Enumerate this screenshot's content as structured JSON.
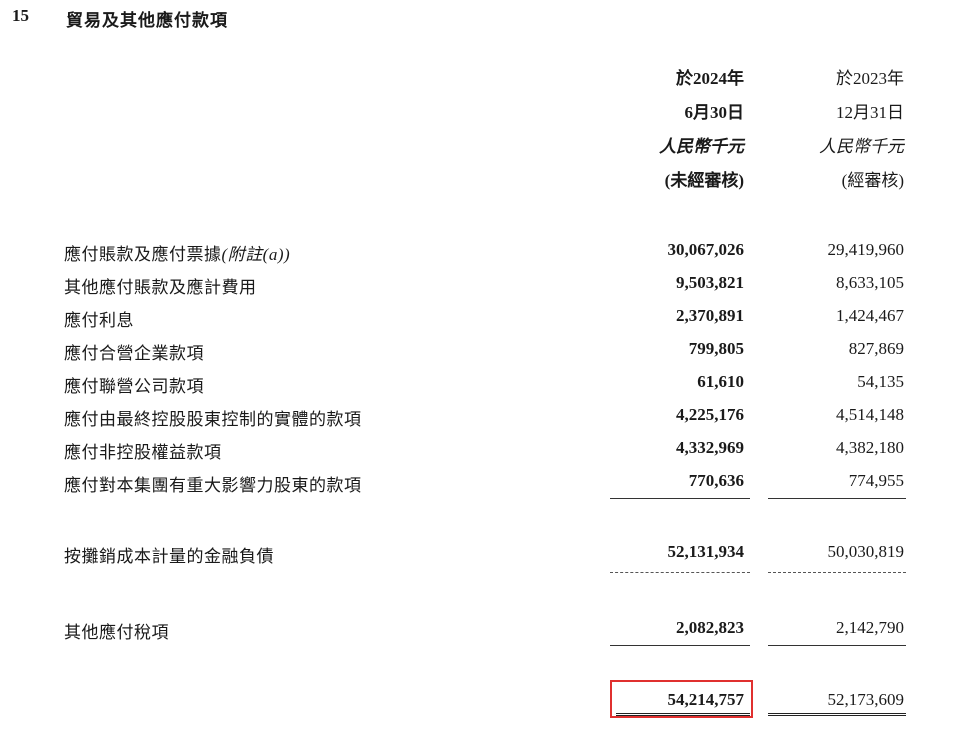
{
  "section": {
    "number": "15",
    "title": "貿易及其他應付款項"
  },
  "headers": {
    "current": {
      "line1": "於2024年",
      "line2": "6月30日",
      "line3": "人民幣千元",
      "line4": "(未經審核)"
    },
    "prior": {
      "line1": "於2023年",
      "line2": "12月31日",
      "line3": "人民幣千元",
      "line4": "(經審核)"
    }
  },
  "rows": [
    {
      "label": "應付賬款及應付票據",
      "note": "(附註(a))",
      "current": "30,067,026",
      "prior": "29,419,960"
    },
    {
      "label": "其他應付賬款及應計費用",
      "current": "9,503,821",
      "prior": "8,633,105"
    },
    {
      "label": "應付利息",
      "current": "2,370,891",
      "prior": "1,424,467"
    },
    {
      "label": "應付合營企業款項",
      "current": "799,805",
      "prior": "827,869"
    },
    {
      "label": "應付聯營公司款項",
      "current": "61,610",
      "prior": "54,135"
    },
    {
      "label": "應付由最終控股股東控制的實體的款項",
      "current": "4,225,176",
      "prior": "4,514,148"
    },
    {
      "label": "應付非控股權益款項",
      "current": "4,332,969",
      "prior": "4,382,180"
    },
    {
      "label": "應付對本集團有重大影響力股東的款項",
      "current": "770,636",
      "prior": "774,955"
    }
  ],
  "subtotal": {
    "label": "按攤銷成本計量的金融負債",
    "current": "52,131,934",
    "prior": "50,030,819"
  },
  "other_tax": {
    "label": "其他應付稅項",
    "current": "2,082,823",
    "prior": "2,142,790"
  },
  "total": {
    "current": "54,214,757",
    "prior": "52,173,609"
  },
  "colors": {
    "highlight_border": "#e0302f",
    "text": "#1a1a1a"
  }
}
